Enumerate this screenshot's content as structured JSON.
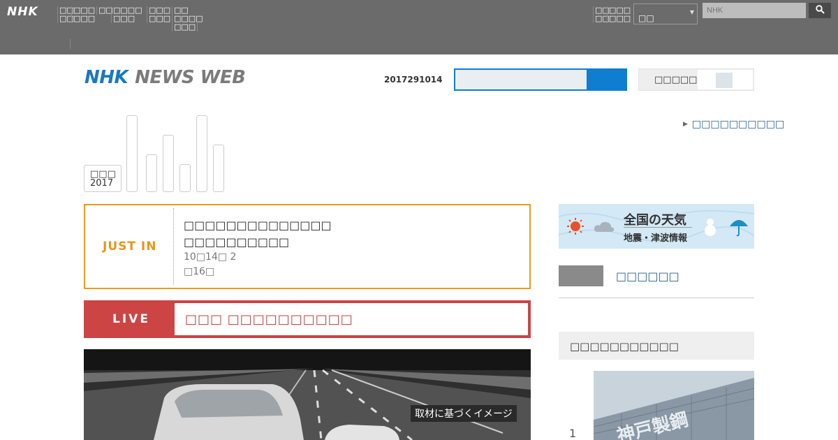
{
  "global_nav": {
    "logo": "NHK",
    "items": [
      "□□\n□□",
      "□□□\n□□□",
      "□□",
      "□□□□\n□□□",
      "□□□\n□□□",
      "□□\n□□□□\n□□□",
      "□□\n□□",
      "□□□\n□□□"
    ],
    "select_value": "□□",
    "search_placeholder": "NHK"
  },
  "header": {
    "logo_nhk": "NHK",
    "logo_text": "NEWS WEB",
    "date_code": "2017291014",
    "font_size_label": "□□□□□"
  },
  "date_box": {
    "label": "□□□",
    "year": "2017"
  },
  "top_link": "□□□□□□□□□□",
  "just_in": {
    "label": "JUST IN",
    "title": "□□□□□□□□□□□□□□\n□□□□□□□□□□",
    "meta": "10□14□ 2\n□16□"
  },
  "live": {
    "label": "LIVE",
    "title": "□□□ □□□□□□□□□□"
  },
  "video": {
    "caption": "取材に基づくイメージ"
  },
  "weather": {
    "title": "全国の天気",
    "subtitle": "地震・津波情報"
  },
  "share_link": "□□□□□□",
  "ranking": {
    "heading": "□□□□□□□□□□□",
    "items": [
      {
        "rank": "1",
        "image_text": "神戸製鋼"
      }
    ]
  },
  "colors": {
    "topbar": "#6b6b6b",
    "brand_blue": "#1a78c2",
    "just_in_orange": "#ec9a1e",
    "live_red": "#cc4444",
    "link_blue": "#1f5e8a"
  },
  "icons": {
    "search": "magnifier-icon",
    "weather_sun": "sun-icon",
    "weather_cloud": "cloud-icon",
    "weather_snowman": "snowman-icon",
    "weather_umbrella": "umbrella-icon"
  }
}
